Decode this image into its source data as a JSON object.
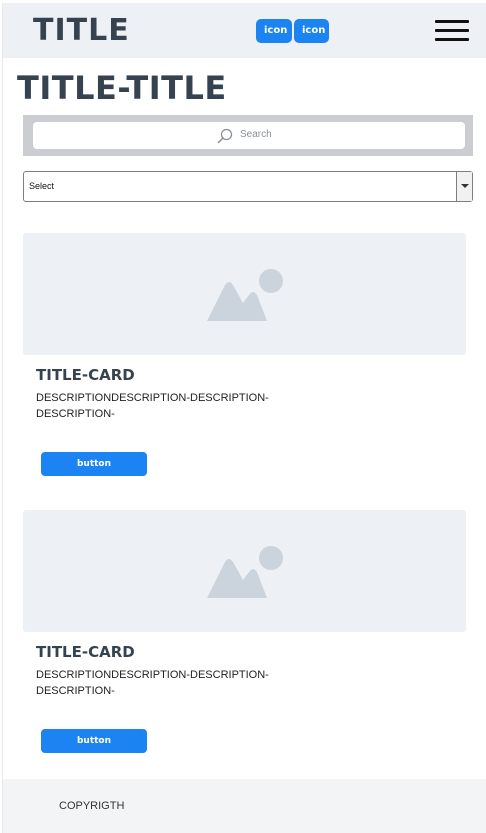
{
  "header": {
    "logo": "TITLE",
    "icon_buttons": [
      "icon",
      "icon"
    ],
    "menu_icon": "hamburger-menu-icon"
  },
  "page": {
    "title": "TITLE-TITLE"
  },
  "search": {
    "placeholder": "Search",
    "icon": "search-icon"
  },
  "filter": {
    "selected": "Select"
  },
  "cards": [
    {
      "image_icon": "image-placeholder-icon",
      "title": "TITLE-CARD",
      "description": "DESCRIPTIONDESCRIPTION-DESCRIPTION-DESCRIPTION-",
      "button": "button"
    },
    {
      "image_icon": "image-placeholder-icon",
      "title": "TITLE-CARD",
      "description": "DESCRIPTIONDESCRIPTION-DESCRIPTION-DESCRIPTION-",
      "button": "button"
    }
  ],
  "footer": {
    "copyright": "COPYRIGTH"
  },
  "colors": {
    "accent": "#1c84f2",
    "header_bg": "#edf0f4",
    "text": "#36424f"
  }
}
